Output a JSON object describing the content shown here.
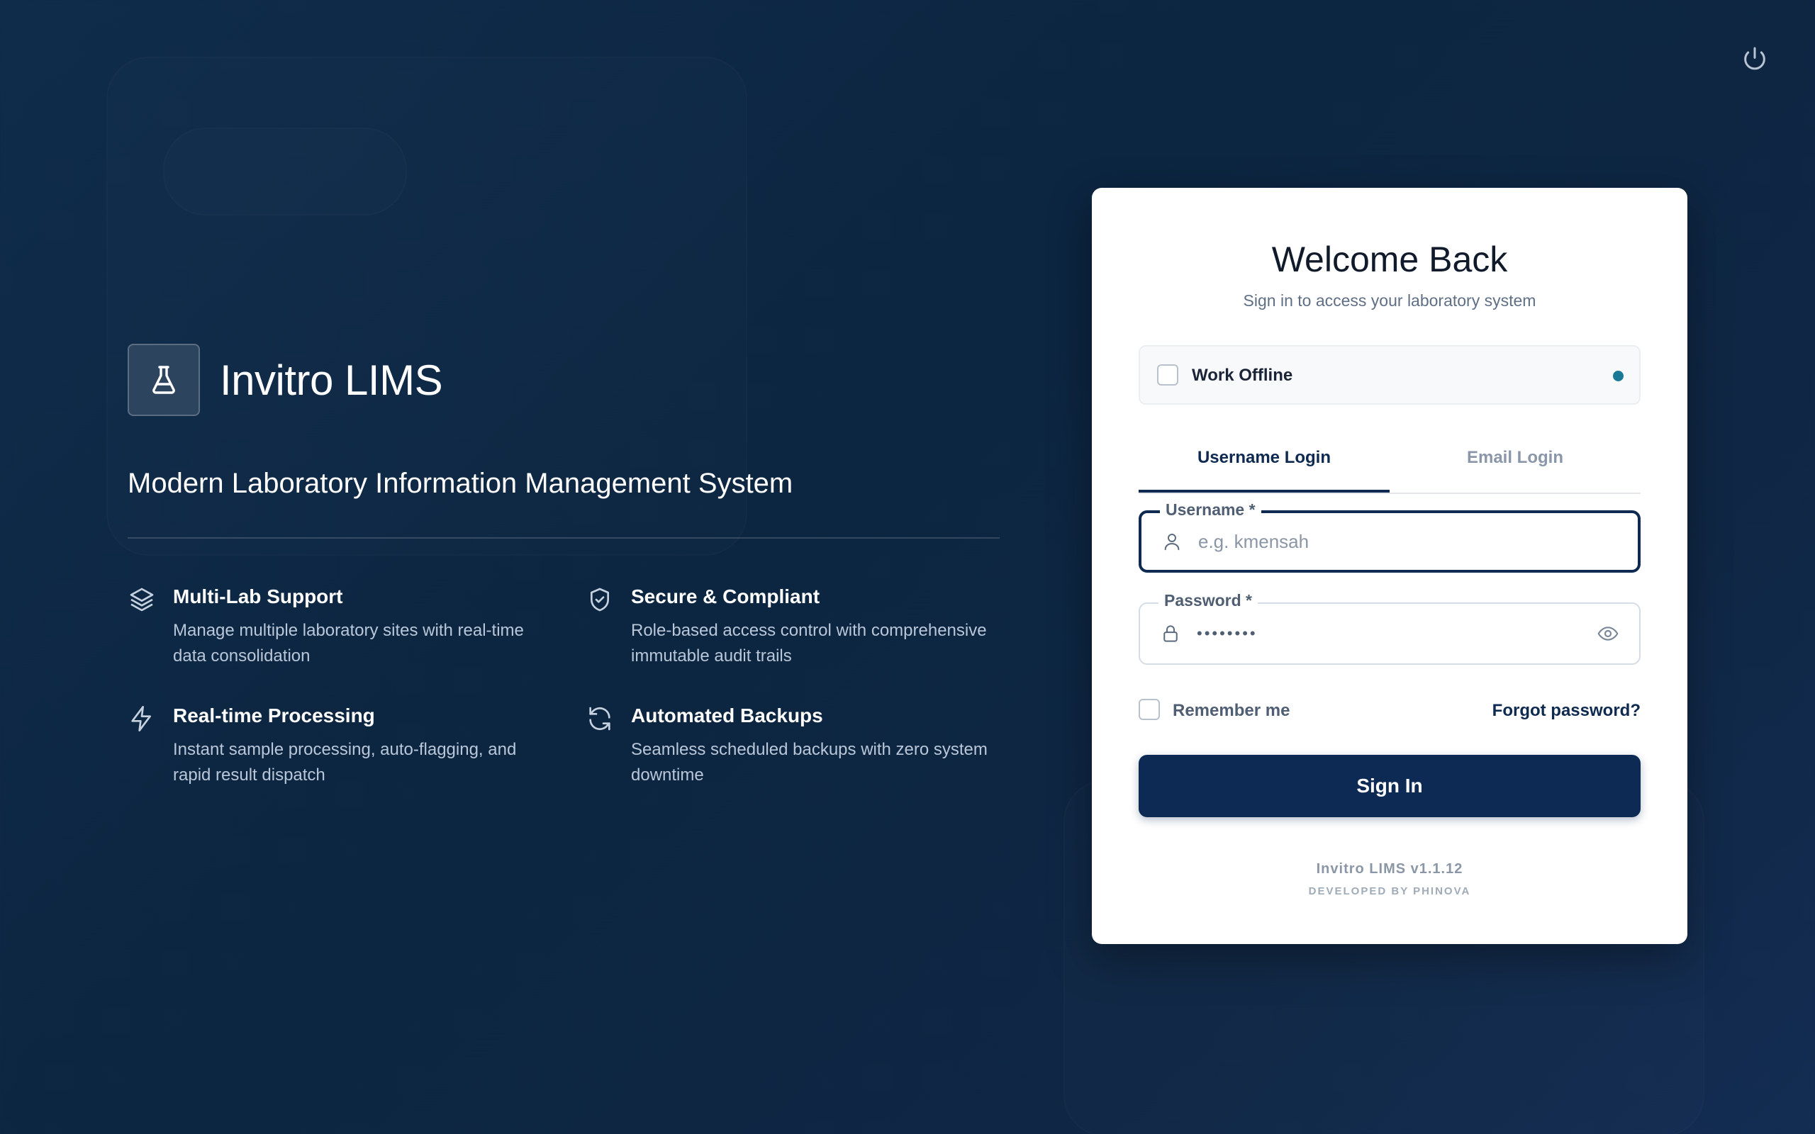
{
  "app": {
    "name": "Invitro LIMS",
    "tagline": "Modern Laboratory Information Management System",
    "logo_icon": "flask-icon"
  },
  "header": {
    "power_icon": "power-icon"
  },
  "features": [
    {
      "icon": "layers-icon",
      "title": "Multi-Lab Support",
      "description": "Manage multiple laboratory sites with real-time data consolidation"
    },
    {
      "icon": "shield-check-icon",
      "title": "Secure & Compliant",
      "description": "Role-based access control with comprehensive immutable audit trails"
    },
    {
      "icon": "lightning-icon",
      "title": "Real-time Processing",
      "description": "Instant sample processing, auto-flagging, and rapid result dispatch"
    },
    {
      "icon": "refresh-icon",
      "title": "Automated Backups",
      "description": "Seamless scheduled backups with zero system downtime"
    }
  ],
  "login": {
    "title": "Welcome Back",
    "subtitle": "Sign in to access your laboratory system",
    "work_offline_label": "Work Offline",
    "work_offline_checked": false,
    "status_dot_color": "#1a7a96",
    "tabs": [
      {
        "label": "Username Login",
        "active": true
      },
      {
        "label": "Email Login",
        "active": false
      }
    ],
    "username": {
      "label": "Username *",
      "placeholder": "e.g. kmensah",
      "value": ""
    },
    "password": {
      "label": "Password *",
      "masked_value": "••••••••"
    },
    "remember_label": "Remember me",
    "remember_checked": false,
    "forgot_label": "Forgot password?",
    "signin_label": "Sign In",
    "version": "Invitro LIMS v1.1.12",
    "developer": "DEVELOPED BY PHINOVA"
  },
  "colors": {
    "primary": "#0c2a54",
    "background": "#0f2c4b",
    "accent_dot": "#1a7a96"
  }
}
